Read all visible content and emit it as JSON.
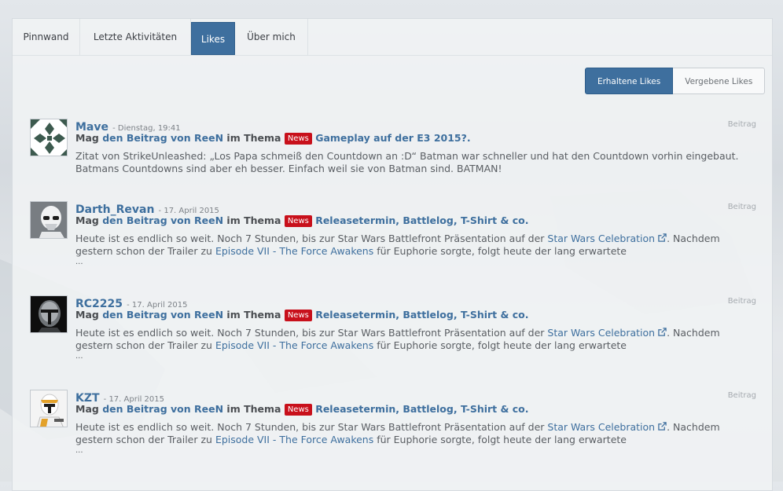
{
  "tabs": [
    {
      "label": "Pinnwand",
      "active": false
    },
    {
      "label": "Letzte Aktivitäten",
      "active": false
    },
    {
      "label": "Likes",
      "active": true
    },
    {
      "label": "Über mich",
      "active": false
    }
  ],
  "like_filter": {
    "received": "Erhaltene Likes",
    "given": "Vergebene Likes"
  },
  "entries": [
    {
      "user": "Mave",
      "date": "- Dienstag, 19:41",
      "type": "Beitrag",
      "action_prefix": "Mag",
      "post_link": "den Beitrag von ReeN",
      "topic_prefix": "im Thema",
      "badge": "News",
      "thread": "Gameplay auf der E3 2015?.",
      "excerpt": "Zitat von StrikeUnleashed: „Los Papa schmeiß den Countdown an :D“ Batman war schneller und hat den Countdown vorhin eingebaut. Batmans Countdowns sind aber eh besser. Einfach weil sie von Batman sind. BATMAN!"
    },
    {
      "user": "Darth_Revan",
      "date": "- 17. April 2015",
      "type": "Beitrag",
      "action_prefix": "Mag",
      "post_link": "den Beitrag von ReeN",
      "topic_prefix": "im Thema",
      "badge": "News",
      "thread": "Releasetermin, Battlelog, T-Shirt & co.",
      "excerpt_a": "Heute ist es endlich so weit. Noch 7 Stunden, bis zur Star Wars Battlefront Präsentation auf der ",
      "excerpt_link1": "Star Wars Celebration",
      "excerpt_b": ". Nachdem gestern schon der Trailer zu ",
      "excerpt_link2": "Episode VII - The Force Awakens",
      "excerpt_c": " für Euphorie sorgte, folgt heute der lang erwartete",
      "ellipsis": "..."
    },
    {
      "user": "RC2225",
      "date": "- 17. April 2015",
      "type": "Beitrag",
      "action_prefix": "Mag",
      "post_link": "den Beitrag von ReeN",
      "topic_prefix": "im Thema",
      "badge": "News",
      "thread": "Releasetermin, Battlelog, T-Shirt & co.",
      "excerpt_a": "Heute ist es endlich so weit. Noch 7 Stunden, bis zur Star Wars Battlefront Präsentation auf der ",
      "excerpt_link1": "Star Wars Celebration",
      "excerpt_b": ". Nachdem gestern schon der Trailer zu ",
      "excerpt_link2": "Episode VII - The Force Awakens",
      "excerpt_c": " für Euphorie sorgte, folgt heute der lang erwartete",
      "ellipsis": "..."
    },
    {
      "user": "KZT",
      "date": "- 17. April 2015",
      "type": "Beitrag",
      "action_prefix": "Mag",
      "post_link": "den Beitrag von ReeN",
      "topic_prefix": "im Thema",
      "badge": "News",
      "thread": "Releasetermin, Battlelog, T-Shirt & co.",
      "excerpt_a": "Heute ist es endlich so weit. Noch 7 Stunden, bis zur Star Wars Battlefront Präsentation auf der ",
      "excerpt_link1": "Star Wars Celebration",
      "excerpt_b": ". Nachdem gestern schon der Trailer zu ",
      "excerpt_link2": "Episode VII - The Force Awakens",
      "excerpt_c": " für Euphorie sorgte, folgt heute der lang erwartete",
      "ellipsis": "..."
    }
  ],
  "icons": {
    "external_link": "external-link-icon"
  },
  "colors": {
    "accent": "#3e6f9e",
    "badge": "#c8101b"
  }
}
